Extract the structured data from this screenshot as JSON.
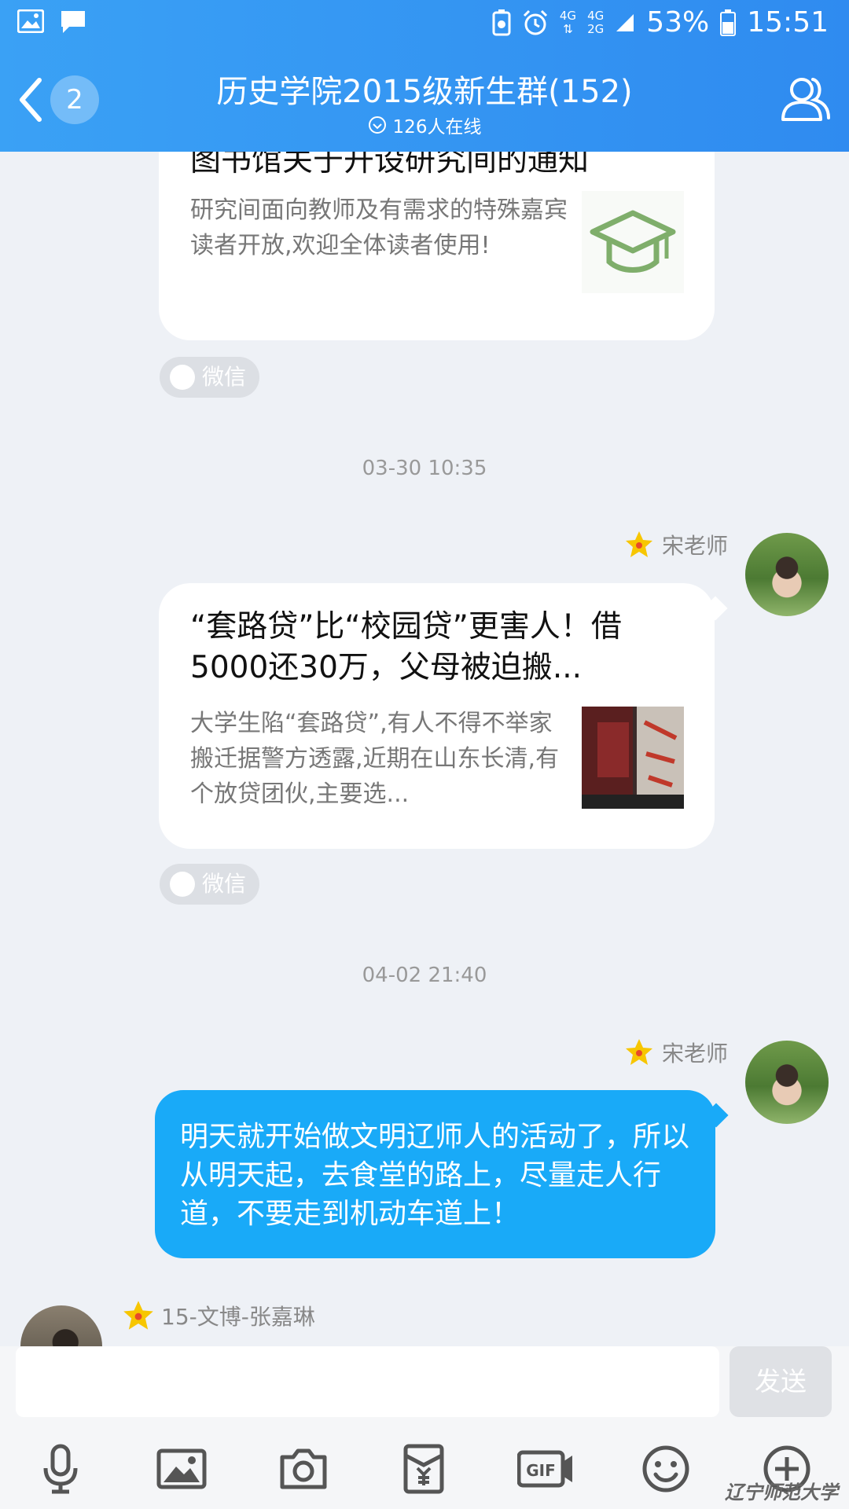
{
  "status_bar": {
    "battery": "53%",
    "time": "15:51",
    "network_top": "4G",
    "network_mid": "4G",
    "network_bot": "2G"
  },
  "header": {
    "back_count": "2",
    "title": "历史学院2015级新生群(152)",
    "online": "126人在线"
  },
  "messages": [
    {
      "title": "图书馆关于开设研究间的通知",
      "desc": "研究间面向教师及有需求的特殊嘉宾读者开放,欢迎全体读者使用!",
      "source": "微信"
    },
    {
      "time": "03-30 10:35",
      "sender": "宋老师",
      "title": "“套路贷”比“校园贷”更害人！借5000还30万，父母被迫搬...",
      "desc": "大学生陷“套路贷”,有人不得不举家搬迁据警方透露,近期在山东长清,有个放贷团伙,主要选...",
      "source": "微信"
    },
    {
      "time": "04-02 21:40",
      "sender": "宋老师",
      "text": "明天就开始做文明辽师人的活动了，所以从明天起，去食堂的路上，尽量走人行道，不要走到机动车道上！"
    },
    {
      "sender": "15-文博-张嘉琳"
    }
  ],
  "input": {
    "send_label": "发送"
  },
  "toolbar": {
    "icons": [
      "microphone-icon",
      "image-icon",
      "camera-icon",
      "red-packet-icon",
      "gif-icon",
      "emoji-icon",
      "plus-icon"
    ]
  },
  "watermark": "辽宁师范大学",
  "colors": {
    "header": "#3aa1f5",
    "bubble": "#19aaf8",
    "star": "#f7c600"
  }
}
